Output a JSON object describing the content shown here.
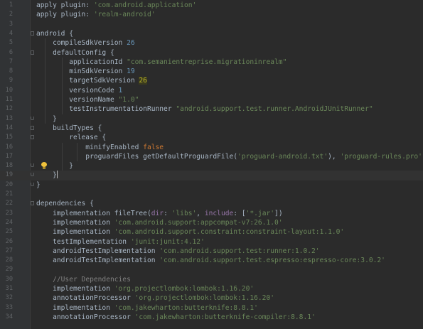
{
  "editor": {
    "current_line": 19,
    "lines": [
      {
        "n": "1",
        "t": "apply plugin: 'com.android.application'"
      },
      {
        "n": "2",
        "t": "apply plugin: 'realm-android'"
      },
      {
        "n": "3",
        "t": ""
      },
      {
        "n": "4",
        "t": "android {"
      },
      {
        "n": "5",
        "t": "    compileSdkVersion 26"
      },
      {
        "n": "6",
        "t": "    defaultConfig {"
      },
      {
        "n": "7",
        "t": "        applicationId \"com.semanientreprise.migrationinrealm\""
      },
      {
        "n": "8",
        "t": "        minSdkVersion 19"
      },
      {
        "n": "9",
        "t": "        targetSdkVersion 26"
      },
      {
        "n": "10",
        "t": "        versionCode 1"
      },
      {
        "n": "11",
        "t": "        versionName \"1.0\""
      },
      {
        "n": "12",
        "t": "        testInstrumentationRunner \"android.support.test.runner.AndroidJUnitRunner\""
      },
      {
        "n": "13",
        "t": "    }"
      },
      {
        "n": "14",
        "t": "    buildTypes {"
      },
      {
        "n": "15",
        "t": "        release {"
      },
      {
        "n": "16",
        "t": "            minifyEnabled false"
      },
      {
        "n": "17",
        "t": "            proguardFiles getDefaultProguardFile('proguard-android.txt'), 'proguard-rules.pro'"
      },
      {
        "n": "18",
        "t": "        }"
      },
      {
        "n": "19",
        "t": "    }"
      },
      {
        "n": "20",
        "t": "}"
      },
      {
        "n": "21",
        "t": ""
      },
      {
        "n": "22",
        "t": "dependencies {"
      },
      {
        "n": "23",
        "t": "    implementation fileTree(dir: 'libs', include: ['*.jar'])"
      },
      {
        "n": "24",
        "t": "    implementation 'com.android.support:appcompat-v7:26.1.0'"
      },
      {
        "n": "25",
        "t": "    implementation 'com.android.support.constraint:constraint-layout:1.1.0'"
      },
      {
        "n": "26",
        "t": "    testImplementation 'junit:junit:4.12'"
      },
      {
        "n": "27",
        "t": "    androidTestImplementation 'com.android.support.test:runner:1.0.2'"
      },
      {
        "n": "28",
        "t": "    androidTestImplementation 'com.android.support.test.espresso:espresso-core:3.0.2'"
      },
      {
        "n": "29",
        "t": ""
      },
      {
        "n": "30",
        "t": "    //User Dependencies"
      },
      {
        "n": "31",
        "t": "    implementation 'org.projectlombok:lombok:1.16.20'"
      },
      {
        "n": "32",
        "t": "    annotationProcessor 'org.projectlombok:lombok:1.16.20'"
      },
      {
        "n": "33",
        "t": "    implementation 'com.jakewharton:butterknife:8.8.1'"
      },
      {
        "n": "34",
        "t": "    annotationProcessor 'com.jakewharton:butterknife-compiler:8.8.1'"
      }
    ]
  },
  "colors": {
    "background": "#2b2b2b",
    "keyword": "#cc7832",
    "string": "#6a8759",
    "number": "#6897bb",
    "text": "#a9b7c6",
    "comment": "#808080"
  }
}
